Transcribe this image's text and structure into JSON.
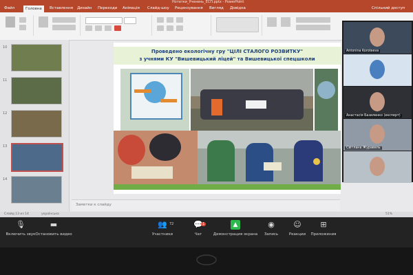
{
  "app": {
    "window_title": "Нотатки_Ученень_ЕСП.pptx - PowerPoint",
    "tabs": [
      "Файл",
      "Головна",
      "Вставлення",
      "Дизайн",
      "Переходи",
      "Анімація",
      "Слайд-шоу",
      "Рецензування",
      "Вигляд",
      "Довідка"
    ],
    "active_tab": "Головна",
    "share_label": "Спільний доступ"
  },
  "thumbnails": [
    {
      "num": "10",
      "color": "#6f7d4f"
    },
    {
      "num": "11",
      "color": "#5d6c48"
    },
    {
      "num": "12",
      "color": "#7a6a4c"
    },
    {
      "num": "13",
      "color": "#4e6a8a"
    },
    {
      "num": "14",
      "color": "#6a7f8f"
    }
  ],
  "slide": {
    "title_line1": "Проведено екологічну гру \"ЦІЛІ СТАЛОГО РОЗВИТКУ\"",
    "title_line2": "з учнями  КУ \"Вишевицький ліцей\" та Вишевицької спецшколи"
  },
  "notes_placeholder": "Заметки к слайду",
  "status": {
    "slide_counter": "Слайд 13 из 14",
    "language": "українська",
    "zoom": "51%"
  },
  "participants": [
    {
      "name": "Antonina Koroteeva",
      "color": "#3c4a5c"
    },
    {
      "name": "",
      "color": "#d7e3ee"
    },
    {
      "name": "Анастасія Базиленко (експерт)",
      "color": "#2e3036"
    },
    {
      "name": "Світлана Журавель",
      "color": "#8f9aa6"
    },
    {
      "name": "",
      "color": "#b8c0c8"
    }
  ],
  "zoom_bar": {
    "mute_label": "Включить звук",
    "video_label": "Остановить видео",
    "participants_label": "Участники",
    "participants_count": "72",
    "chat_label": "Чат",
    "chat_badge": "1",
    "share_label": "Демонстрация экрана",
    "record_label": "Запись",
    "reactions_label": "Реакции",
    "apps_label": "Приложения",
    "share_color": "#2db94d"
  }
}
